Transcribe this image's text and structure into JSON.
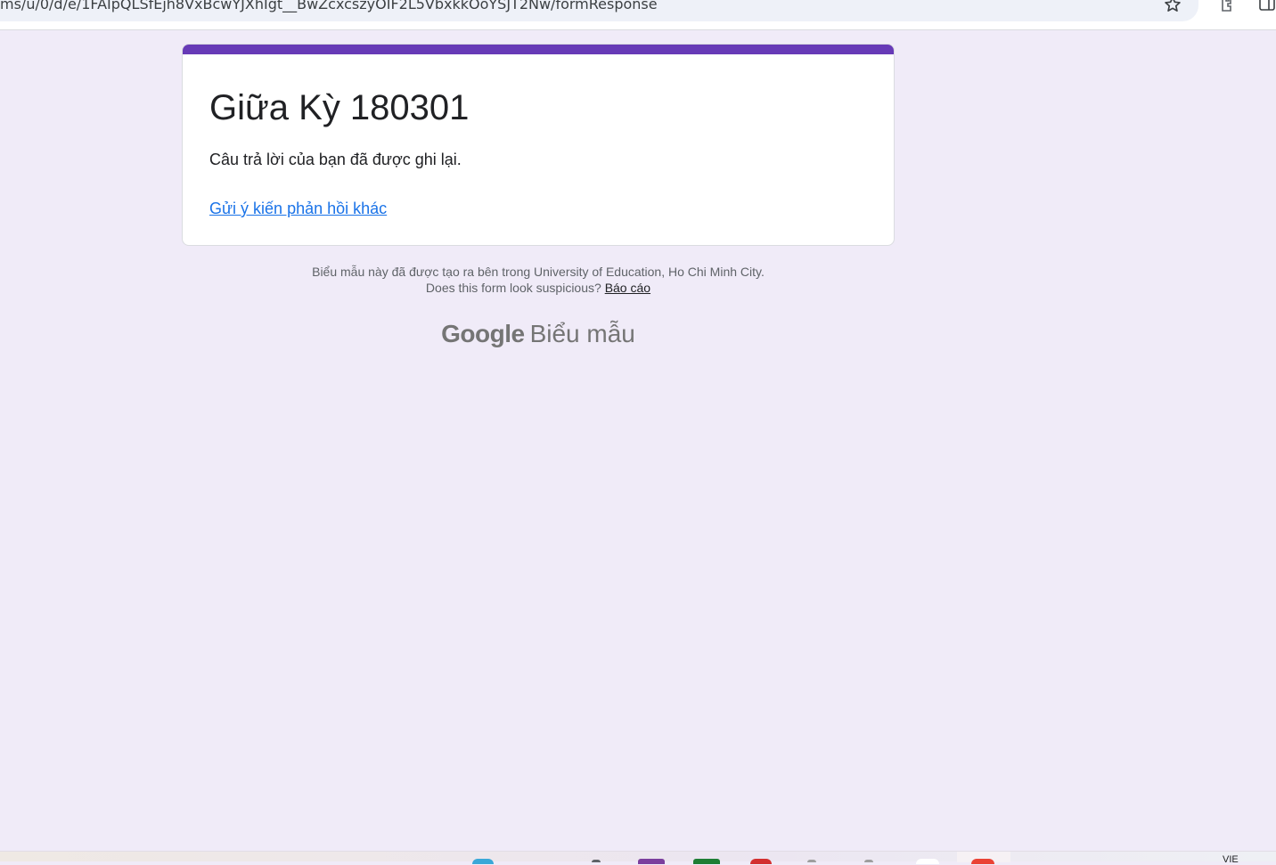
{
  "browser": {
    "url": "ms/u/0/d/e/1FAIpQLSfEjh8VxBcwYJXhIgt__BwZcxcszyOIF2L5VbxkkOoYSJT2Nw/formResponse"
  },
  "form": {
    "title": "Giữa Kỳ 180301",
    "confirmation": "Câu trả lời của bạn đã được ghi lại.",
    "submit_another_label": "Gửi ý kiến phản hồi khác",
    "accent_color": "#673ab7"
  },
  "footer": {
    "created_in": "Biểu mẫu này đã được tạo ra bên trong University of Education, Ho Chi Minh City.",
    "suspicious_question": "Does this form look suspicious?",
    "report_label": "Báo cáo",
    "brand_google": "Google",
    "brand_product": "Biểu mẫu"
  },
  "taskbar": {
    "language": "VIE"
  },
  "icons": {
    "star": "star-icon",
    "extensions": "extensions-icon",
    "side_panel": "side-panel-icon"
  }
}
